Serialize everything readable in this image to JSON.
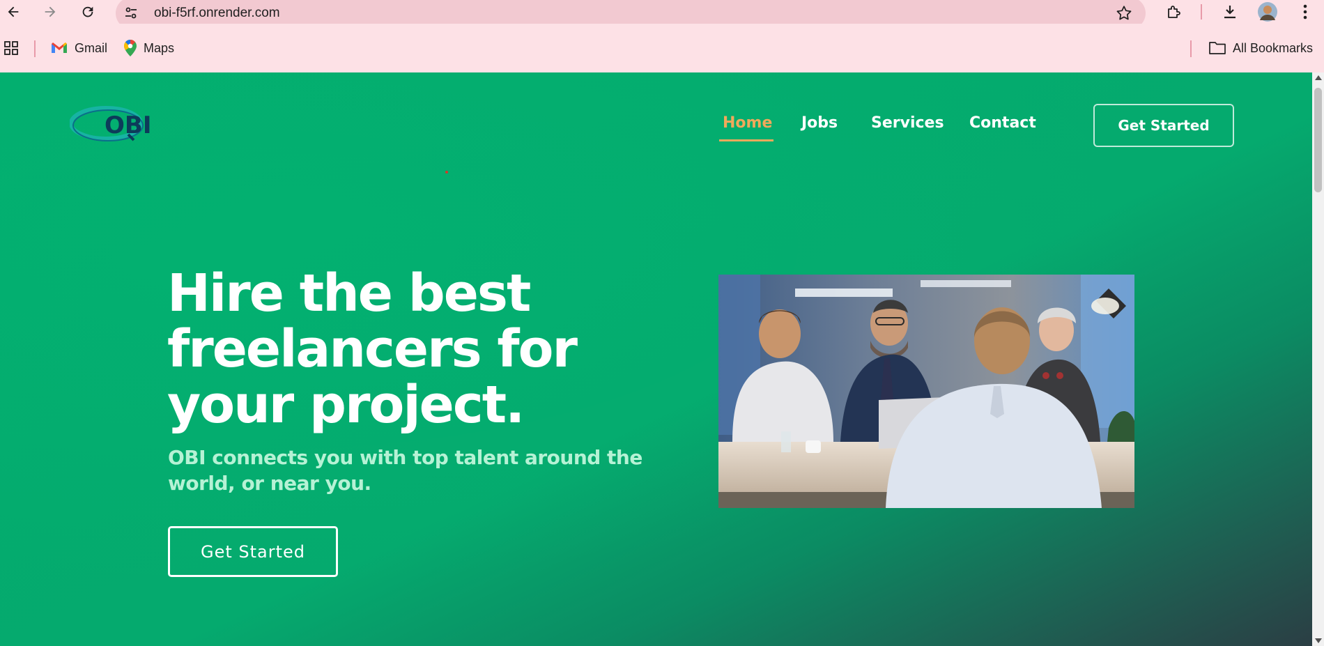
{
  "browser": {
    "url": "obi-f5rf.onrender.com",
    "bookmarks": [
      {
        "label": "Gmail",
        "icon": "gmail-icon"
      },
      {
        "label": "Maps",
        "icon": "maps-icon"
      }
    ],
    "all_bookmarks_label": "All Bookmarks"
  },
  "site": {
    "logo_text": "OBI",
    "nav": [
      {
        "label": "Home",
        "active": true
      },
      {
        "label": "Jobs",
        "active": false
      },
      {
        "label": "Services",
        "active": false
      },
      {
        "label": "Contact",
        "active": false
      }
    ],
    "header_button": "Get Started",
    "accent_color": "#f1a95b",
    "brand_green": "#03ad6e"
  },
  "hero": {
    "title": "Hire the best freelancers for your project.",
    "subtitle": "OBI connects you with top talent around the world, or near you.",
    "button": "Get Started",
    "image_description_icon": "meeting-photo"
  }
}
